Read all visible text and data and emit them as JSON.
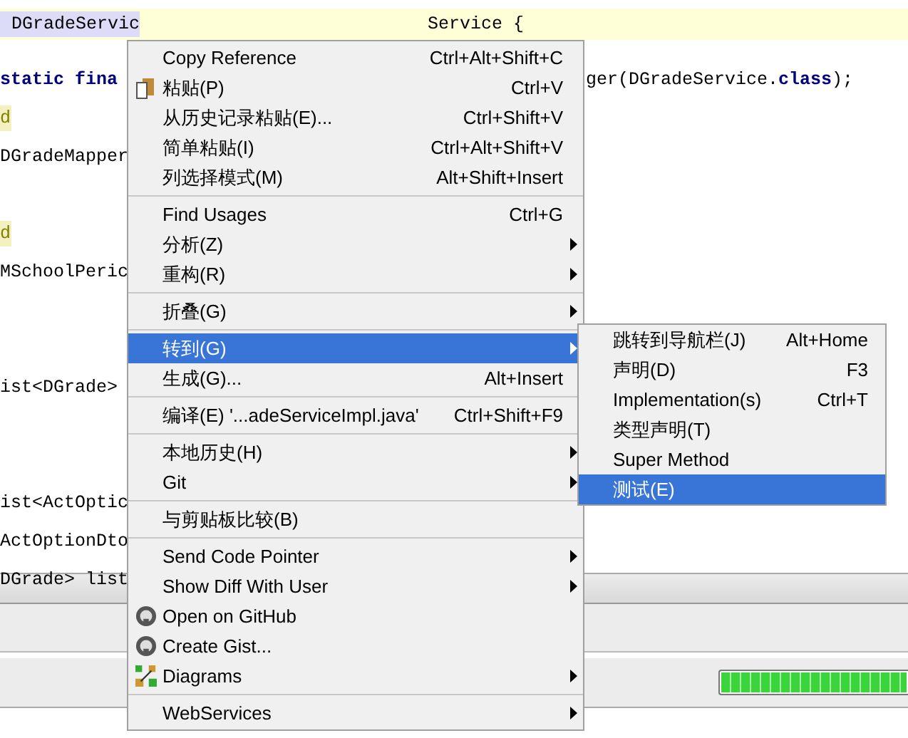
{
  "editor": {
    "blocks": [
      [
        {
          "left": [
            {
              "text": "DGradeServic",
              "kind": "selection"
            }
          ],
          "right": [
            {
              "text": "Service {",
              "kind": "plain"
            }
          ]
        },
        {
          "left": [
            {
              "text": "static",
              "kind": "keyword"
            },
            {
              "text": "fina",
              "kind": "keyword"
            }
          ],
          "after_menu": [
            {
              "text": "ger(DGradeService.",
              "kind": "plain"
            },
            {
              "text": "class",
              "kind": "keyword"
            },
            {
              "text": ");",
              "kind": "plain"
            }
          ]
        },
        {
          "left": [
            {
              "text": "d",
              "kind": "annotation"
            }
          ]
        },
        {
          "left": [
            {
              "text": "DGradeMapper",
              "kind": "plain"
            }
          ]
        }
      ],
      [
        {
          "left": [
            {
              "text": "d",
              "kind": "annotation"
            }
          ]
        },
        {
          "left": [
            {
              "text": "MSchoolPeric",
              "kind": "plain"
            }
          ]
        }
      ],
      [
        {
          "left": [
            {
              "text": "ist<DGrade>",
              "kind": "plain"
            }
          ]
        }
      ],
      [
        {
          "left": [
            {
              "text": "ist<ActOptic",
              "kind": "plain"
            }
          ]
        },
        {
          "left": [
            {
              "text": "ActOptionDto",
              "kind": "plain"
            }
          ]
        },
        {
          "left": [
            {
              "text": "DGrade> list",
              "kind": "plain"
            }
          ]
        }
      ]
    ]
  },
  "status_bar": {
    "progress": {
      "level": 1
    }
  },
  "context_menu": {
    "groups": [
      [
        {
          "label": "Copy Reference",
          "shortcut": "Ctrl+Alt+Shift+C",
          "submenu": false,
          "kind": "plain",
          "selected": false
        },
        {
          "label": "粘贴(P)",
          "shortcut": "Ctrl+V",
          "submenu": false,
          "kind": "paste",
          "selected": false
        },
        {
          "label": "从历史记录粘贴(E)...",
          "shortcut": "Ctrl+Shift+V",
          "submenu": false,
          "kind": "plain",
          "selected": false
        },
        {
          "label": "简单粘贴(I)",
          "shortcut": "Ctrl+Alt+Shift+V",
          "submenu": false,
          "kind": "plain",
          "selected": false
        },
        {
          "label": "列选择模式(M)",
          "shortcut": "Alt+Shift+Insert",
          "submenu": false,
          "kind": "plain",
          "selected": false
        }
      ],
      [
        {
          "label": "Find Usages",
          "shortcut": "Ctrl+G",
          "submenu": false,
          "kind": "plain",
          "selected": false
        },
        {
          "label": "分析(Z)",
          "submenu": true,
          "kind": "plain",
          "selected": false
        },
        {
          "label": "重构(R)",
          "submenu": true,
          "kind": "plain",
          "selected": false
        }
      ],
      [
        {
          "label": "折叠(G)",
          "submenu": true,
          "kind": "plain",
          "selected": false
        }
      ],
      [
        {
          "label": "转到(G)",
          "submenu": true,
          "kind": "plain",
          "selected": true
        },
        {
          "label": "生成(G)...",
          "shortcut": "Alt+Insert",
          "submenu": false,
          "kind": "plain",
          "selected": false
        }
      ],
      [
        {
          "label": "编译(E) '...adeServiceImpl.java'",
          "shortcut": "Ctrl+Shift+F9",
          "submenu": false,
          "kind": "plain",
          "selected": false
        }
      ],
      [
        {
          "label": "本地历史(H)",
          "submenu": true,
          "kind": "plain",
          "selected": false
        },
        {
          "label": "Git",
          "submenu": true,
          "kind": "plain",
          "selected": false
        }
      ],
      [
        {
          "label": "与剪贴板比较(B)",
          "submenu": false,
          "kind": "plain",
          "selected": false
        }
      ],
      [
        {
          "label": "Send Code Pointer",
          "submenu": true,
          "kind": "plain",
          "selected": false
        },
        {
          "label": "Show Diff With User",
          "submenu": true,
          "kind": "plain",
          "selected": false
        },
        {
          "label": "Open on GitHub",
          "submenu": false,
          "kind": "github",
          "selected": false
        },
        {
          "label": "Create Gist...",
          "submenu": false,
          "kind": "github",
          "selected": false
        },
        {
          "label": "Diagrams",
          "submenu": true,
          "kind": "diagram",
          "selected": false
        }
      ],
      [
        {
          "label": "WebServices",
          "submenu": true,
          "kind": "plain",
          "selected": false
        }
      ]
    ]
  },
  "submenu": {
    "items": [
      {
        "label": "跳转到导航栏(J)",
        "shortcut": "Alt+Home",
        "selected": false
      },
      {
        "label": "声明(D)",
        "shortcut": "F3",
        "selected": false
      },
      {
        "label": "Implementation(s)",
        "shortcut": "Ctrl+T",
        "selected": false
      },
      {
        "label": "类型声明(T)",
        "selected": false
      },
      {
        "label": "Super Method",
        "selected": false
      },
      {
        "label": "测试(E)",
        "selected": true
      }
    ]
  }
}
